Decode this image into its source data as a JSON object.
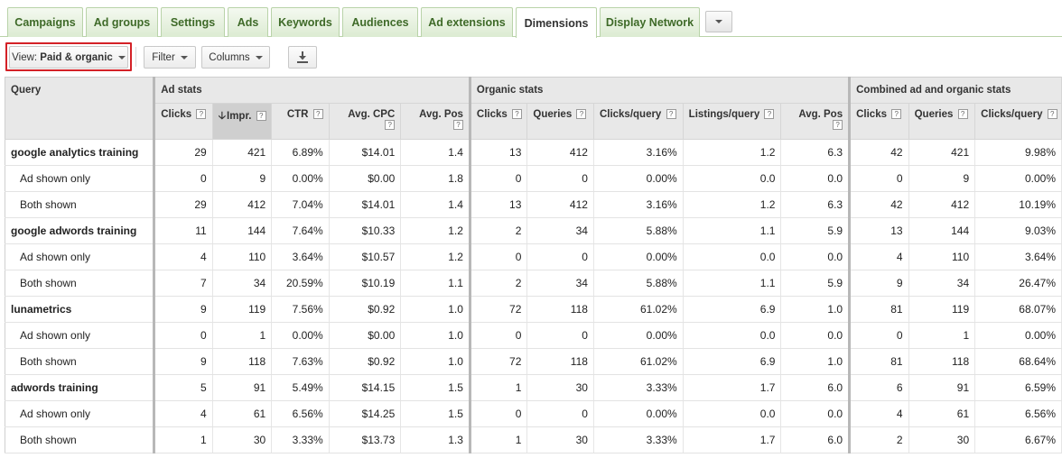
{
  "tabs": [
    {
      "label": "Campaigns"
    },
    {
      "label": "Ad groups"
    },
    {
      "label": "Settings"
    },
    {
      "label": "Ads"
    },
    {
      "label": "Keywords"
    },
    {
      "label": "Audiences"
    },
    {
      "label": "Ad extensions"
    },
    {
      "label": "Dimensions",
      "active": true
    },
    {
      "label": "Display Network"
    }
  ],
  "toolbar": {
    "view_prefix": "View: ",
    "view_value": "Paid & organic",
    "filter_label": "Filter",
    "columns_label": "Columns",
    "download_icon": "download-icon",
    "highlight_color": "#d42127"
  },
  "table": {
    "query_header": "Query",
    "groups": [
      "Ad stats",
      "Organic stats",
      "Combined ad and organic stats"
    ],
    "columns": {
      "ad": [
        "Clicks",
        "Impr.",
        "CTR",
        "Avg. CPC",
        "Avg. Pos"
      ],
      "organic": [
        "Clicks",
        "Queries",
        "Clicks/query",
        "Listings/query",
        "Avg. Pos"
      ],
      "combined": [
        "Clicks",
        "Queries",
        "Clicks/query"
      ]
    },
    "help_glyph": "?",
    "sort_glyph": "🡣",
    "rows": [
      {
        "type": "parent",
        "cells": [
          "google analytics training",
          "29",
          "421",
          "6.89%",
          "$14.01",
          "1.4",
          "13",
          "412",
          "3.16%",
          "1.2",
          "6.3",
          "42",
          "421",
          "9.98%"
        ]
      },
      {
        "type": "child",
        "cells": [
          "Ad shown only",
          "0",
          "9",
          "0.00%",
          "$0.00",
          "1.8",
          "0",
          "0",
          "0.00%",
          "0.0",
          "0.0",
          "0",
          "9",
          "0.00%"
        ]
      },
      {
        "type": "child",
        "cells": [
          "Both shown",
          "29",
          "412",
          "7.04%",
          "$14.01",
          "1.4",
          "13",
          "412",
          "3.16%",
          "1.2",
          "6.3",
          "42",
          "412",
          "10.19%"
        ]
      },
      {
        "type": "parent",
        "cells": [
          "google adwords training",
          "11",
          "144",
          "7.64%",
          "$10.33",
          "1.2",
          "2",
          "34",
          "5.88%",
          "1.1",
          "5.9",
          "13",
          "144",
          "9.03%"
        ]
      },
      {
        "type": "child",
        "cells": [
          "Ad shown only",
          "4",
          "110",
          "3.64%",
          "$10.57",
          "1.2",
          "0",
          "0",
          "0.00%",
          "0.0",
          "0.0",
          "4",
          "110",
          "3.64%"
        ]
      },
      {
        "type": "child",
        "cells": [
          "Both shown",
          "7",
          "34",
          "20.59%",
          "$10.19",
          "1.1",
          "2",
          "34",
          "5.88%",
          "1.1",
          "5.9",
          "9",
          "34",
          "26.47%"
        ]
      },
      {
        "type": "parent",
        "cells": [
          "lunametrics",
          "9",
          "119",
          "7.56%",
          "$0.92",
          "1.0",
          "72",
          "118",
          "61.02%",
          "6.9",
          "1.0",
          "81",
          "119",
          "68.07%"
        ]
      },
      {
        "type": "child",
        "cells": [
          "Ad shown only",
          "0",
          "1",
          "0.00%",
          "$0.00",
          "1.0",
          "0",
          "0",
          "0.00%",
          "0.0",
          "0.0",
          "0",
          "1",
          "0.00%"
        ]
      },
      {
        "type": "child",
        "cells": [
          "Both shown",
          "9",
          "118",
          "7.63%",
          "$0.92",
          "1.0",
          "72",
          "118",
          "61.02%",
          "6.9",
          "1.0",
          "81",
          "118",
          "68.64%"
        ]
      },
      {
        "type": "parent",
        "cells": [
          "adwords training",
          "5",
          "91",
          "5.49%",
          "$14.15",
          "1.5",
          "1",
          "30",
          "3.33%",
          "1.7",
          "6.0",
          "6",
          "91",
          "6.59%"
        ]
      },
      {
        "type": "child",
        "cells": [
          "Ad shown only",
          "4",
          "61",
          "6.56%",
          "$14.25",
          "1.5",
          "0",
          "0",
          "0.00%",
          "0.0",
          "0.0",
          "4",
          "61",
          "6.56%"
        ]
      },
      {
        "type": "child",
        "cells": [
          "Both shown",
          "1",
          "30",
          "3.33%",
          "$13.73",
          "1.3",
          "1",
          "30",
          "3.33%",
          "1.7",
          "6.0",
          "2",
          "30",
          "6.67%"
        ]
      }
    ]
  }
}
